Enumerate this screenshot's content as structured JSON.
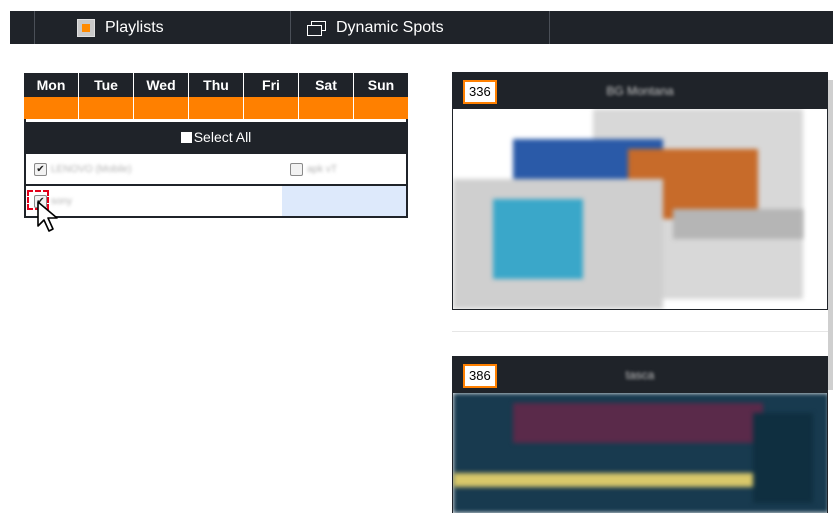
{
  "nav": {
    "playlists_label": "Playlists",
    "dynamic_spots_label": "Dynamic Spots"
  },
  "schedule": {
    "days": [
      "Mon",
      "Tue",
      "Wed",
      "Thu",
      "Fri",
      "Sat",
      "Sun"
    ],
    "select_all_label": "Select All",
    "devices": [
      {
        "label": "LENOVO (Mobile)",
        "checked": true
      },
      {
        "label": "apk vT",
        "checked": false
      },
      {
        "label": "sony",
        "checked": true
      }
    ]
  },
  "cards": [
    {
      "id": "336",
      "name": "BG Montana"
    },
    {
      "id": "386",
      "name": "tasca"
    }
  ],
  "colors": {
    "accent": "#ff8000",
    "dark": "#1f2329",
    "highlight": "#dde9fb",
    "focus": "#e2001a"
  }
}
